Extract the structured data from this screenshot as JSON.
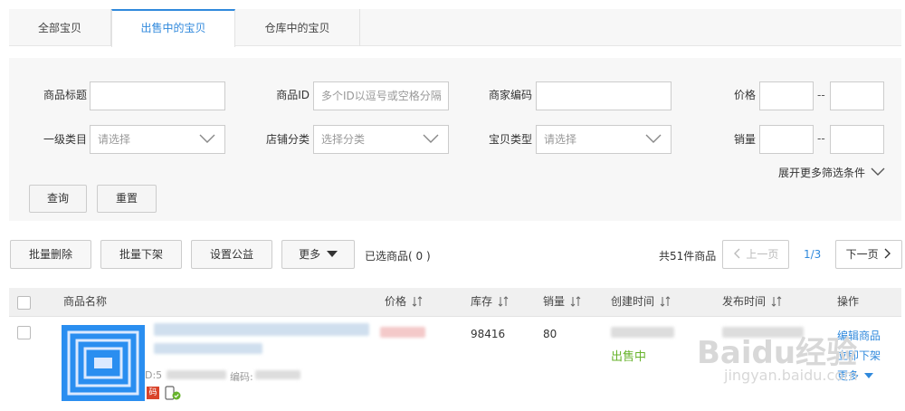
{
  "tabs": [
    {
      "label": "全部宝贝",
      "active": false
    },
    {
      "label": "出售中的宝贝",
      "active": true
    },
    {
      "label": "仓库中的宝贝",
      "active": false
    }
  ],
  "filters": {
    "title_label": "商品标题",
    "id_label": "商品ID",
    "id_placeholder": "多个ID以逗号或空格分隔",
    "merchant_code_label": "商家编码",
    "price_label": "价格",
    "category_label": "一级类目",
    "category_placeholder": "请选择",
    "shop_category_label": "店铺分类",
    "shop_category_placeholder": "选择分类",
    "item_type_label": "宝贝类型",
    "item_type_placeholder": "请选择",
    "sales_label": "销量",
    "range_sep": "--",
    "expand_label": "展开更多筛选条件",
    "search_button": "查询",
    "reset_button": "重置"
  },
  "toolbar": {
    "batch_delete": "批量删除",
    "batch_delist": "批量下架",
    "set_charity": "设置公益",
    "more": "更多",
    "selected": "已选商品( 0 )",
    "total": "共51件商品",
    "prev": "上一页",
    "page": "1/3",
    "next": "下一页"
  },
  "table": {
    "headers": {
      "name": "商品名称",
      "price": "价格",
      "stock": "库存",
      "sales": "销量",
      "created": "创建时间",
      "published": "发布时间",
      "ops": "操作"
    },
    "rows": [
      {
        "id_prefix": "D:5",
        "code_label": "编码:",
        "badge": "码",
        "stock": "98416",
        "sales": "80",
        "status": "出售中",
        "ops": [
          "编辑商品",
          "立即下架",
          "更多"
        ]
      }
    ]
  },
  "watermark": {
    "brand": "Baidu经验",
    "url": "jingyan.baidu.com"
  },
  "colors": {
    "accent": "#3089dc",
    "status_green": "#67b32b",
    "panel_bg": "#f7f7f7"
  }
}
